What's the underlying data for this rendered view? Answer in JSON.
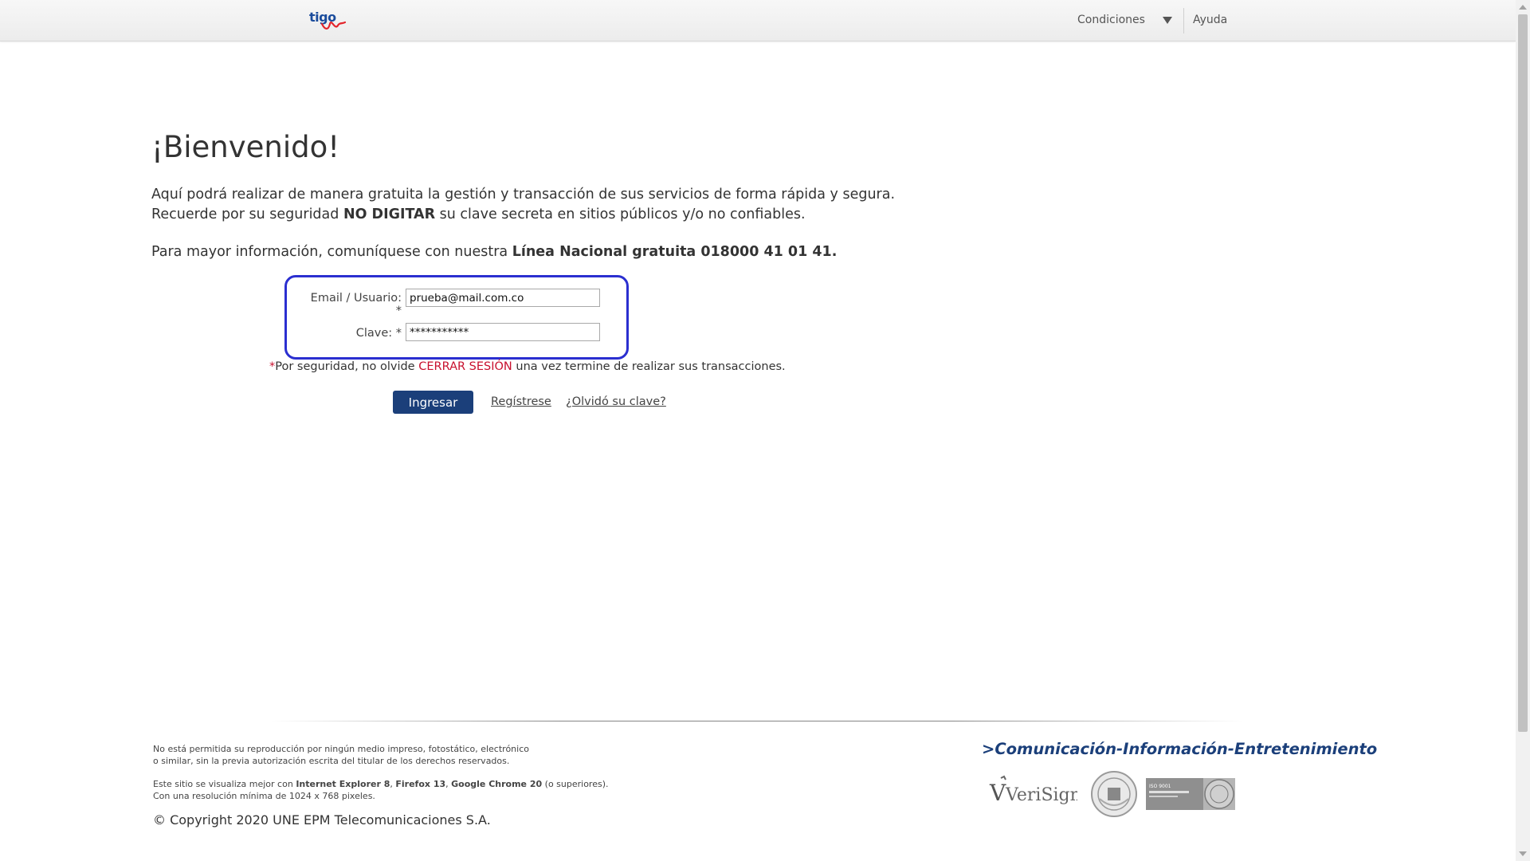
{
  "header": {
    "logo_text": "tigo",
    "nav_condiciones": "Condiciones",
    "nav_ayuda": "Ayuda"
  },
  "main": {
    "title": "¡Bienvenido!",
    "intro_line1": "Aquí podrá realizar de manera gratuita la gestión y transacción de sus servicios de forma rápida y segura.",
    "intro_line2_pre": "Recuerde por su seguridad ",
    "intro_line2_bold": "NO DIGITAR",
    "intro_line2_post": " su clave secreta en sitios públicos y/o no confiables.",
    "info_pre": "Para mayor información, comuníquese con nuestra ",
    "info_bold": "Línea Nacional gratuita 018000 41 01 41."
  },
  "login": {
    "email_label": "Email / Usuario: *",
    "email_value": "prueba@mail.com.co",
    "password_label": "Clave: *",
    "password_value": "***********",
    "security_star": "*",
    "security_pre": "Por seguridad, no olvide ",
    "security_link": "CERRAR SESIÓN",
    "security_post": " una vez termine de realizar sus transacciones.",
    "submit_label": "Ingresar",
    "register_label": "Regístrese",
    "forgot_label": "¿Olvidó su clave?"
  },
  "footer": {
    "legal_1a": "No está permitida su reproducción por ningún medio impreso, fotostático, electrónico",
    "legal_1b": "o similar, sin la previa autorización escrita del titular de los derechos reservados.",
    "legal_2_pre": "Este sitio se visualiza mejor con ",
    "browser_ie": "Internet Explorer 8",
    "sep1": ", ",
    "browser_ff": "Firefox 13",
    "sep2": ", ",
    "browser_chrome": "Google Chrome 20",
    "legal_2_post": " (o superiores).",
    "legal_2b": "Con una resolución mínima de 1024 x 768 pixeles.",
    "copyright": "© Copyright 2020 UNE EPM Telecomunicaciones S.A.",
    "tagline": ">Comunicación-Información-Entretenimiento",
    "badge_verisign": "VeriSign",
    "badge_bv_text": "ISO 9001"
  },
  "colors": {
    "brand_blue": "#1b3f7a",
    "focus_outline": "#2b2fd0",
    "alert_red": "#c8102e"
  }
}
